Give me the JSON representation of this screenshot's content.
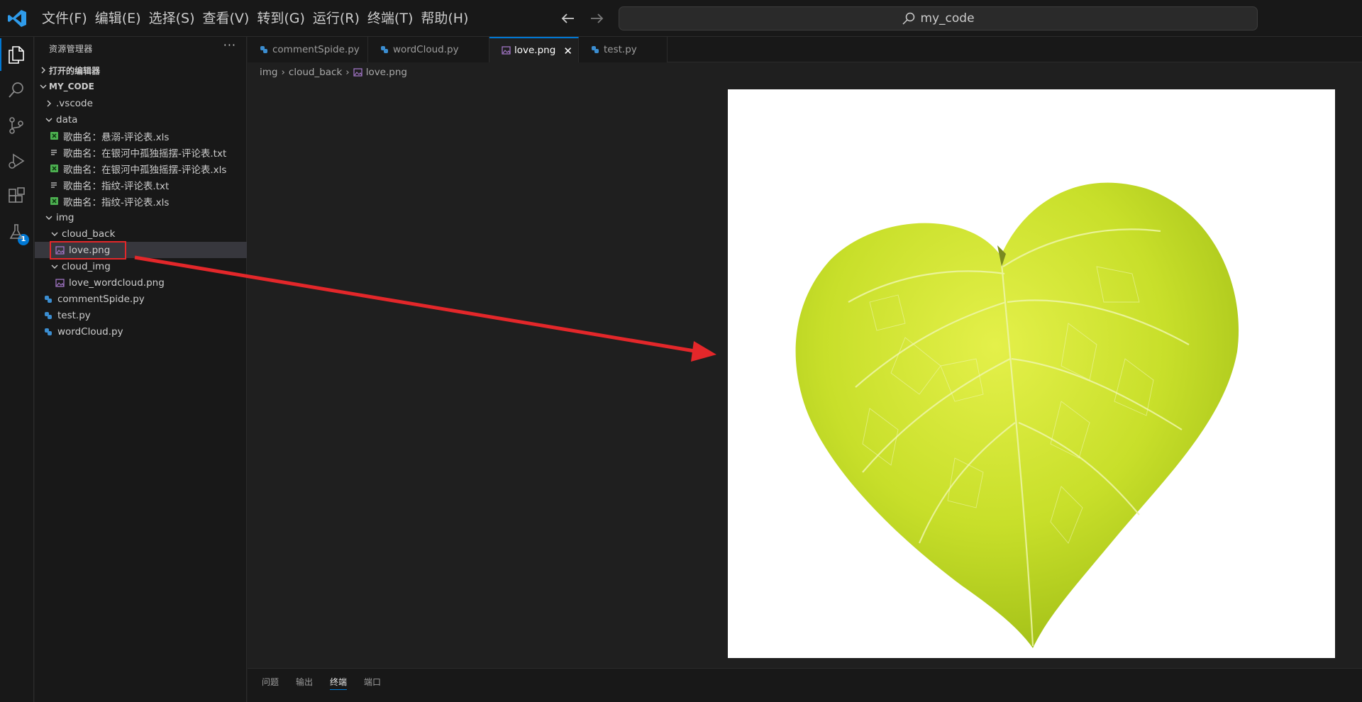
{
  "menu": [
    "文件(F)",
    "编辑(E)",
    "选择(S)",
    "查看(V)",
    "转到(G)",
    "运行(R)",
    "终端(T)",
    "帮助(H)"
  ],
  "search": {
    "text": "my_code"
  },
  "activity_badge": "1",
  "sidebar": {
    "title": "资源管理器",
    "more": "···",
    "open_editors": "打开的编辑器",
    "folder": "MY_CODE",
    "tree": [
      {
        "label": ".vscode",
        "kind": "folder-closed",
        "depth": 1
      },
      {
        "label": "data",
        "kind": "folder-open",
        "depth": 1
      },
      {
        "label": "歌曲名：悬溺-评论表.xls",
        "kind": "xls",
        "depth": 2
      },
      {
        "label": "歌曲名：在银河中孤独摇摆-评论表.txt",
        "kind": "txt",
        "depth": 2
      },
      {
        "label": "歌曲名：在银河中孤独摇摆-评论表.xls",
        "kind": "xls",
        "depth": 2
      },
      {
        "label": "歌曲名：指纹-评论表.txt",
        "kind": "txt",
        "depth": 2
      },
      {
        "label": "歌曲名：指纹-评论表.xls",
        "kind": "xls",
        "depth": 2
      },
      {
        "label": "img",
        "kind": "folder-open",
        "depth": 1
      },
      {
        "label": "cloud_back",
        "kind": "folder-open",
        "depth": 2
      },
      {
        "label": "love.png",
        "kind": "png",
        "depth": 3
      },
      {
        "label": "cloud_img",
        "kind": "folder-open",
        "depth": 2
      },
      {
        "label": "love_wordcloud.png",
        "kind": "png",
        "depth": 3
      },
      {
        "label": "commentSpide.py",
        "kind": "py",
        "depth": 1
      },
      {
        "label": "test.py",
        "kind": "py",
        "depth": 1
      },
      {
        "label": "wordCloud.py",
        "kind": "py",
        "depth": 1
      }
    ],
    "selected_item": "love.png"
  },
  "tabs": [
    {
      "label": "commentSpide.py",
      "kind": "py"
    },
    {
      "label": "wordCloud.py",
      "kind": "py"
    },
    {
      "label": "love.png",
      "kind": "png"
    },
    {
      "label": "test.py",
      "kind": "py"
    }
  ],
  "active_tab": "love.png",
  "breadcrumb": [
    "img",
    "cloud_back",
    "love.png"
  ],
  "panel": {
    "tabs": [
      "问题",
      "输出",
      "终端",
      "端口"
    ],
    "active": "终端"
  },
  "colors": {
    "accent": "#0078d4",
    "annotation": "#e3272a",
    "leaf_light": "#d9eb3c",
    "leaf_dark": "#a6c21a"
  }
}
